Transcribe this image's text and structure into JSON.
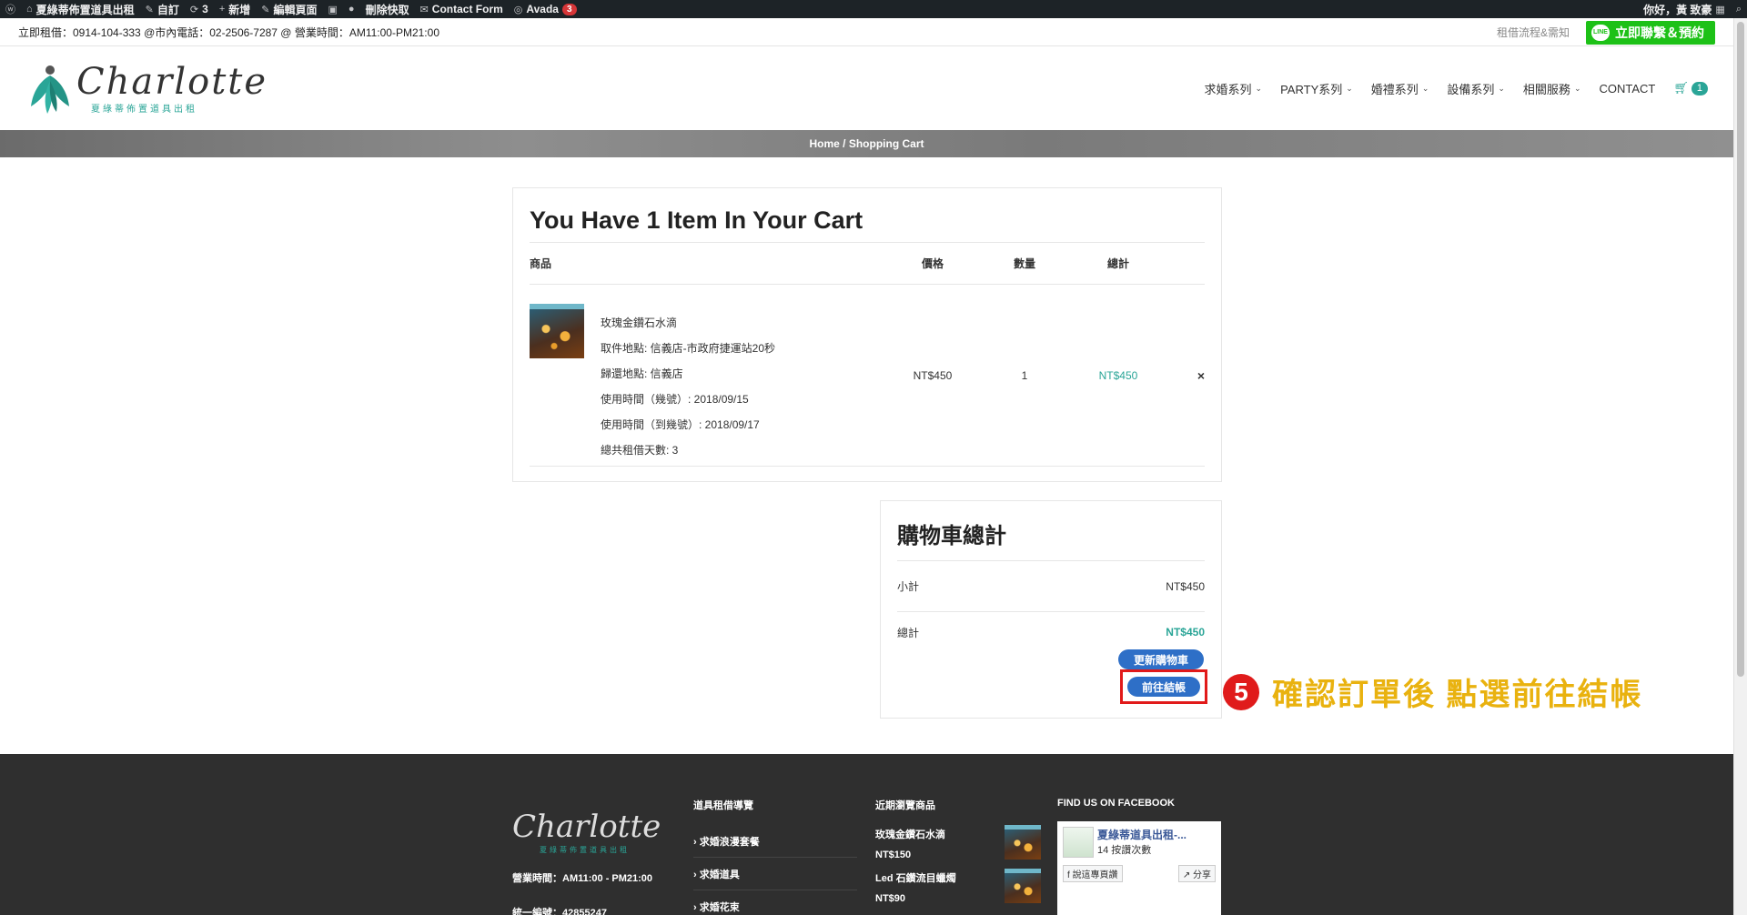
{
  "admin_bar": {
    "site_name": "夏綠蒂佈置道具出租",
    "customize": "自訂",
    "updates": "3",
    "new": "新增",
    "edit_page": "編輯頁面",
    "clear_cache": "刪除快取",
    "contact_form": "Contact Form",
    "avada": "Avada",
    "avada_badge": "3",
    "greeting": "你好，黃 致豪"
  },
  "info_bar": {
    "contact_text": "立即租借：0914-104-333 @市內電話：02-2506-7287 @ 營業時間：AM11:00-PM21:00",
    "flow_link": "租借流程&需知",
    "line_button": "立即聯繫＆預約",
    "line_icon_text": "LINE"
  },
  "logo": {
    "script": "Charlotte",
    "subtitle": "夏綠蒂佈置道具出租"
  },
  "nav": {
    "items": [
      "求婚系列",
      "PARTY系列",
      "婚禮系列",
      "設備系列",
      "相關服務"
    ],
    "contact": "CONTACT",
    "cart_count": "1"
  },
  "breadcrumb": "Home / Shopping Cart",
  "cart": {
    "title": "You Have 1 Item In Your Cart",
    "headers": {
      "product": "商品",
      "price": "價格",
      "qty": "數量",
      "total": "總計"
    },
    "item": {
      "name": "玫瑰金鑽石水滴",
      "details": [
        "取件地點: 信義店-市政府捷運站20秒",
        "歸還地點: 信義店",
        "使用時間（幾號）: 2018/09/15",
        "使用時間（到幾號）: 2018/09/17",
        "總共租借天數: 3"
      ],
      "price": "NT$450",
      "qty": "1",
      "total": "NT$450",
      "remove": "×"
    }
  },
  "totals": {
    "title": "購物車總計",
    "subtotal_label": "小計",
    "subtotal": "NT$450",
    "total_label": "總計",
    "total": "NT$450",
    "update_button": "更新購物車",
    "checkout_button": "前往結帳"
  },
  "annotation": {
    "step": "5",
    "text": "確認訂單後 點選前往結帳"
  },
  "footer": {
    "logo_script": "Charlotte",
    "logo_sub": "夏綠蒂佈置道具出租",
    "hours": "營業時間：AM11:00 - PM21:00",
    "tax_id": "統一編號：42855247",
    "guide_heading": "道具租借導覽",
    "guide_links": [
      "› 求婚浪漫套餐",
      "› 求婚道具",
      "› 求婚花束"
    ],
    "recent_heading": "近期瀏覽商品",
    "recent": [
      {
        "name": "玫瑰金鑽石水滴",
        "price": "NT$150"
      },
      {
        "name": "Led 石鑽流目蠟燭",
        "price": "NT$90"
      }
    ],
    "fb_heading": "FIND US ON FACEBOOK",
    "fb_name": "夏綠蒂道具出租-...",
    "fb_likes": "14 按讚次數",
    "fb_like_btn": "說這專頁讚",
    "fb_share_btn": "分享"
  },
  "colors": {
    "accent": "#2aa597",
    "button": "#2e6fc7",
    "highlight": "#e11a1a",
    "annotation_text": "#e9b20f",
    "line_green": "#1dc117"
  }
}
